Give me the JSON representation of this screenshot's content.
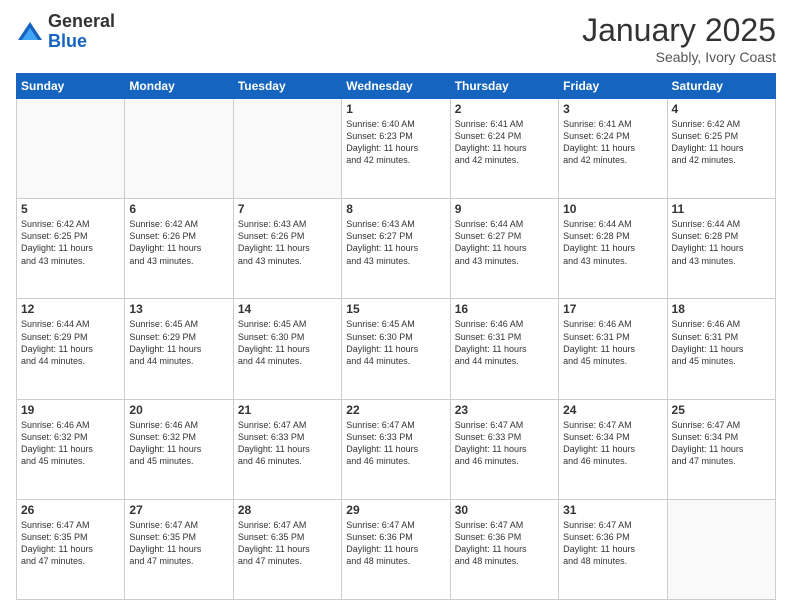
{
  "logo": {
    "general": "General",
    "blue": "Blue"
  },
  "header": {
    "month": "January 2025",
    "location": "Seably, Ivory Coast"
  },
  "weekdays": [
    "Sunday",
    "Monday",
    "Tuesday",
    "Wednesday",
    "Thursday",
    "Friday",
    "Saturday"
  ],
  "weeks": [
    [
      {
        "day": "",
        "info": ""
      },
      {
        "day": "",
        "info": ""
      },
      {
        "day": "",
        "info": ""
      },
      {
        "day": "1",
        "info": "Sunrise: 6:40 AM\nSunset: 6:23 PM\nDaylight: 11 hours\nand 42 minutes."
      },
      {
        "day": "2",
        "info": "Sunrise: 6:41 AM\nSunset: 6:24 PM\nDaylight: 11 hours\nand 42 minutes."
      },
      {
        "day": "3",
        "info": "Sunrise: 6:41 AM\nSunset: 6:24 PM\nDaylight: 11 hours\nand 42 minutes."
      },
      {
        "day": "4",
        "info": "Sunrise: 6:42 AM\nSunset: 6:25 PM\nDaylight: 11 hours\nand 42 minutes."
      }
    ],
    [
      {
        "day": "5",
        "info": "Sunrise: 6:42 AM\nSunset: 6:25 PM\nDaylight: 11 hours\nand 43 minutes."
      },
      {
        "day": "6",
        "info": "Sunrise: 6:42 AM\nSunset: 6:26 PM\nDaylight: 11 hours\nand 43 minutes."
      },
      {
        "day": "7",
        "info": "Sunrise: 6:43 AM\nSunset: 6:26 PM\nDaylight: 11 hours\nand 43 minutes."
      },
      {
        "day": "8",
        "info": "Sunrise: 6:43 AM\nSunset: 6:27 PM\nDaylight: 11 hours\nand 43 minutes."
      },
      {
        "day": "9",
        "info": "Sunrise: 6:44 AM\nSunset: 6:27 PM\nDaylight: 11 hours\nand 43 minutes."
      },
      {
        "day": "10",
        "info": "Sunrise: 6:44 AM\nSunset: 6:28 PM\nDaylight: 11 hours\nand 43 minutes."
      },
      {
        "day": "11",
        "info": "Sunrise: 6:44 AM\nSunset: 6:28 PM\nDaylight: 11 hours\nand 43 minutes."
      }
    ],
    [
      {
        "day": "12",
        "info": "Sunrise: 6:44 AM\nSunset: 6:29 PM\nDaylight: 11 hours\nand 44 minutes."
      },
      {
        "day": "13",
        "info": "Sunrise: 6:45 AM\nSunset: 6:29 PM\nDaylight: 11 hours\nand 44 minutes."
      },
      {
        "day": "14",
        "info": "Sunrise: 6:45 AM\nSunset: 6:30 PM\nDaylight: 11 hours\nand 44 minutes."
      },
      {
        "day": "15",
        "info": "Sunrise: 6:45 AM\nSunset: 6:30 PM\nDaylight: 11 hours\nand 44 minutes."
      },
      {
        "day": "16",
        "info": "Sunrise: 6:46 AM\nSunset: 6:31 PM\nDaylight: 11 hours\nand 44 minutes."
      },
      {
        "day": "17",
        "info": "Sunrise: 6:46 AM\nSunset: 6:31 PM\nDaylight: 11 hours\nand 45 minutes."
      },
      {
        "day": "18",
        "info": "Sunrise: 6:46 AM\nSunset: 6:31 PM\nDaylight: 11 hours\nand 45 minutes."
      }
    ],
    [
      {
        "day": "19",
        "info": "Sunrise: 6:46 AM\nSunset: 6:32 PM\nDaylight: 11 hours\nand 45 minutes."
      },
      {
        "day": "20",
        "info": "Sunrise: 6:46 AM\nSunset: 6:32 PM\nDaylight: 11 hours\nand 45 minutes."
      },
      {
        "day": "21",
        "info": "Sunrise: 6:47 AM\nSunset: 6:33 PM\nDaylight: 11 hours\nand 46 minutes."
      },
      {
        "day": "22",
        "info": "Sunrise: 6:47 AM\nSunset: 6:33 PM\nDaylight: 11 hours\nand 46 minutes."
      },
      {
        "day": "23",
        "info": "Sunrise: 6:47 AM\nSunset: 6:33 PM\nDaylight: 11 hours\nand 46 minutes."
      },
      {
        "day": "24",
        "info": "Sunrise: 6:47 AM\nSunset: 6:34 PM\nDaylight: 11 hours\nand 46 minutes."
      },
      {
        "day": "25",
        "info": "Sunrise: 6:47 AM\nSunset: 6:34 PM\nDaylight: 11 hours\nand 47 minutes."
      }
    ],
    [
      {
        "day": "26",
        "info": "Sunrise: 6:47 AM\nSunset: 6:35 PM\nDaylight: 11 hours\nand 47 minutes."
      },
      {
        "day": "27",
        "info": "Sunrise: 6:47 AM\nSunset: 6:35 PM\nDaylight: 11 hours\nand 47 minutes."
      },
      {
        "day": "28",
        "info": "Sunrise: 6:47 AM\nSunset: 6:35 PM\nDaylight: 11 hours\nand 47 minutes."
      },
      {
        "day": "29",
        "info": "Sunrise: 6:47 AM\nSunset: 6:36 PM\nDaylight: 11 hours\nand 48 minutes."
      },
      {
        "day": "30",
        "info": "Sunrise: 6:47 AM\nSunset: 6:36 PM\nDaylight: 11 hours\nand 48 minutes."
      },
      {
        "day": "31",
        "info": "Sunrise: 6:47 AM\nSunset: 6:36 PM\nDaylight: 11 hours\nand 48 minutes."
      },
      {
        "day": "",
        "info": ""
      }
    ]
  ]
}
